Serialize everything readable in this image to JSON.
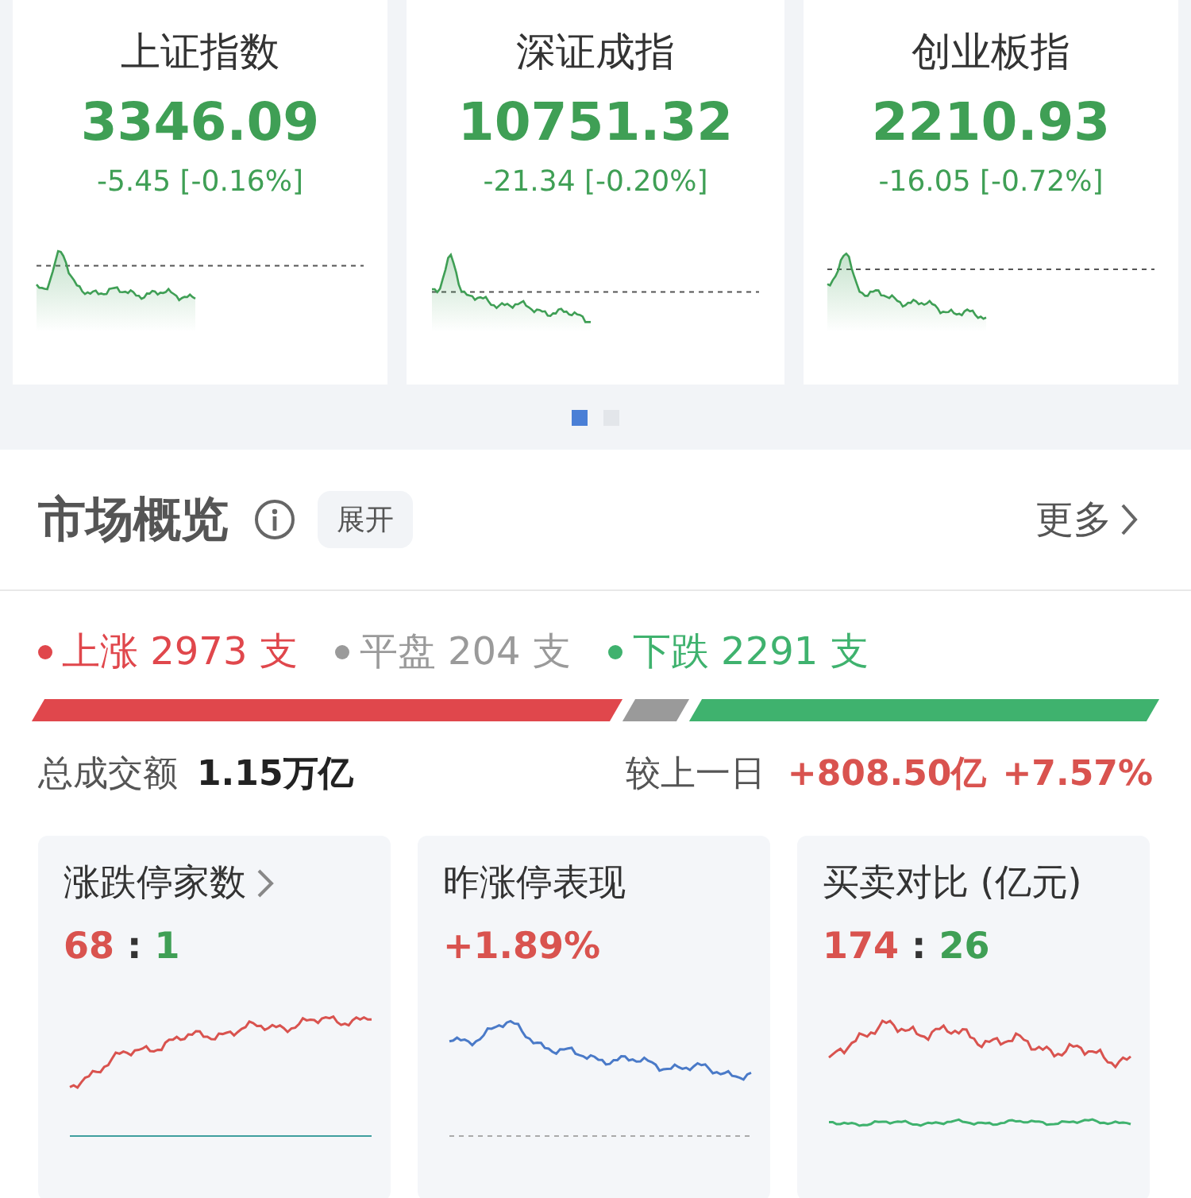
{
  "indices": [
    {
      "name": "上证指数",
      "value": "3346.09",
      "change": "-5.45 [-0.16%]"
    },
    {
      "name": "深证成指",
      "value": "10751.32",
      "change": "-21.34 [-0.20%]"
    },
    {
      "name": "创业板指",
      "value": "2210.93",
      "change": "-16.05 [-0.72%]"
    }
  ],
  "pager": [
    {
      "selected": true
    },
    {
      "selected": false
    }
  ],
  "overview": {
    "title": "市场概览",
    "expand": "展开",
    "more": "更多",
    "stats": [
      {
        "text": "上涨 2973 支",
        "color": "#e0474c"
      },
      {
        "text": "平盘 204 支",
        "color": "#9a9a9a"
      },
      {
        "text": "下跌 2291 支",
        "color": "#3fb26e"
      }
    ],
    "turnover_label": "总成交额",
    "turnover": "1.15万亿",
    "compare_label": "较上一日",
    "compare_value": "+808.50亿",
    "compare_pct": "+7.57%"
  },
  "cards": [
    {
      "kind": "limit",
      "title": "涨跌停家数",
      "link": true,
      "values": [
        {
          "text": "68",
          "color": "#d9534f"
        },
        {
          "text": ":",
          "color": "#333333"
        },
        {
          "text": "1",
          "color": "#3f9f55"
        }
      ]
    },
    {
      "kind": "trend",
      "title": "昨涨停表现",
      "link": false,
      "values": [
        {
          "text": "+1.89%",
          "color": "#d9534f"
        }
      ]
    },
    {
      "kind": "buysell",
      "title": "买卖对比 (亿元)",
      "link": false,
      "values": [
        {
          "text": "174",
          "color": "#d9534f"
        },
        {
          "text": ":",
          "color": "#333333"
        },
        {
          "text": "26",
          "color": "#3f9f55"
        }
      ]
    }
  ]
}
